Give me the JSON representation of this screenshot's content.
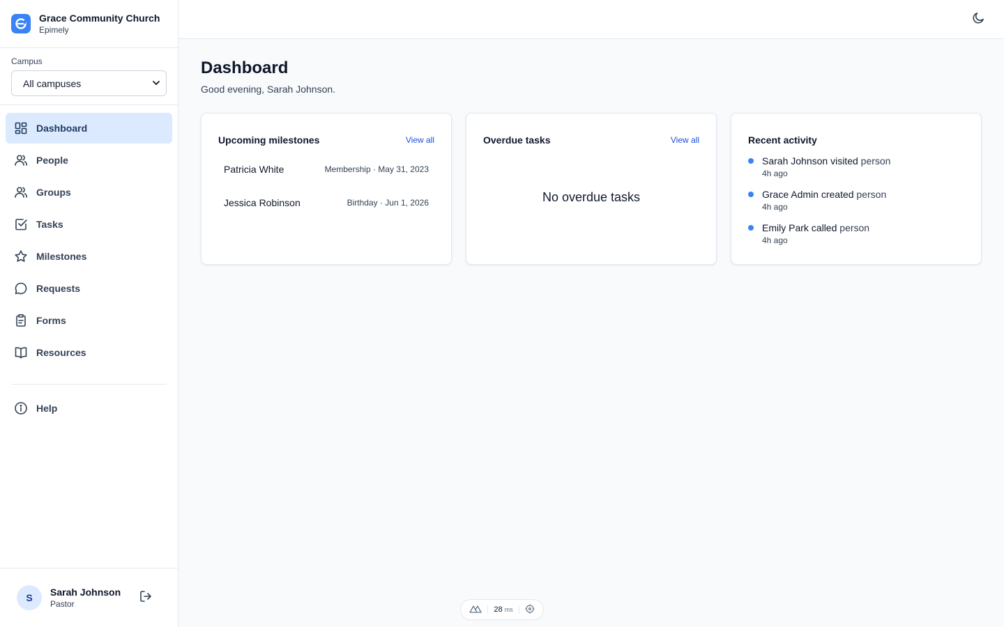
{
  "org": {
    "name": "Grace Community Church",
    "subtitle": "Epimely"
  },
  "campus": {
    "label": "Campus",
    "selected": "All campuses"
  },
  "nav": [
    {
      "label": "Dashboard",
      "icon": "dashboard-icon",
      "active": true
    },
    {
      "label": "People",
      "icon": "people-icon"
    },
    {
      "label": "Groups",
      "icon": "groups-icon"
    },
    {
      "label": "Tasks",
      "icon": "tasks-icon"
    },
    {
      "label": "Milestones",
      "icon": "star-icon"
    },
    {
      "label": "Requests",
      "icon": "chat-icon"
    },
    {
      "label": "Forms",
      "icon": "clipboard-icon"
    },
    {
      "label": "Resources",
      "icon": "book-icon"
    }
  ],
  "help": {
    "label": "Help",
    "icon": "info-icon"
  },
  "user": {
    "initial": "S",
    "name": "Sarah Johnson",
    "role": "Pastor"
  },
  "page": {
    "title": "Dashboard",
    "greeting": "Good evening, Sarah Johnson."
  },
  "milestones": {
    "title": "Upcoming milestones",
    "view_all": "View all",
    "items": [
      {
        "name": "Patricia White",
        "meta": "Membership · May 31, 2023"
      },
      {
        "name": "Jessica Robinson",
        "meta": "Birthday · Jun 1, 2026"
      }
    ]
  },
  "overdue": {
    "title": "Overdue tasks",
    "view_all": "View all",
    "empty": "No overdue tasks"
  },
  "activity": {
    "title": "Recent activity",
    "items": [
      {
        "actor": "Sarah Johnson",
        "verb": "visited",
        "object": "person",
        "time": "4h ago"
      },
      {
        "actor": "Grace Admin",
        "verb": "created",
        "object": "person",
        "time": "4h ago"
      },
      {
        "actor": "Emily Park",
        "verb": "called",
        "object": "person",
        "time": "4h ago"
      }
    ]
  },
  "devtools": {
    "render_time": "28",
    "unit": "ms"
  },
  "colors": {
    "accent": "#3b82f6",
    "active_bg": "#dbeafe",
    "link": "#1d4ed8"
  }
}
